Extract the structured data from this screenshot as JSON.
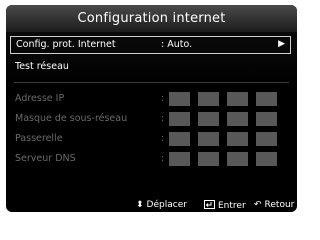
{
  "dialog": {
    "title": "Configuration internet"
  },
  "selected_row": {
    "label": "Config. prot. Internet",
    "value": ": Auto.",
    "arrow_icon": "right-arrow-icon"
  },
  "test_row": {
    "label": "Test réseau"
  },
  "fields": [
    {
      "label": "Adresse IP",
      "colon": ":"
    },
    {
      "label": "Masque de sous-réseau",
      "colon": ":"
    },
    {
      "label": "Passerelle",
      "colon": ":"
    },
    {
      "label": "Serveur DNS",
      "colon": ":"
    }
  ],
  "footer": {
    "move": {
      "label": "Déplacer",
      "icon": "updown-arrows-icon"
    },
    "enter": {
      "label": "Entrer",
      "icon": "enter-icon"
    },
    "return": {
      "label": "Retour",
      "icon": "return-icon"
    }
  },
  "colors": {
    "panel_bg": "#000000",
    "title_bar": "#2e2e2e",
    "disabled_text": "#6a6a6a",
    "ip_box": "#585858"
  }
}
